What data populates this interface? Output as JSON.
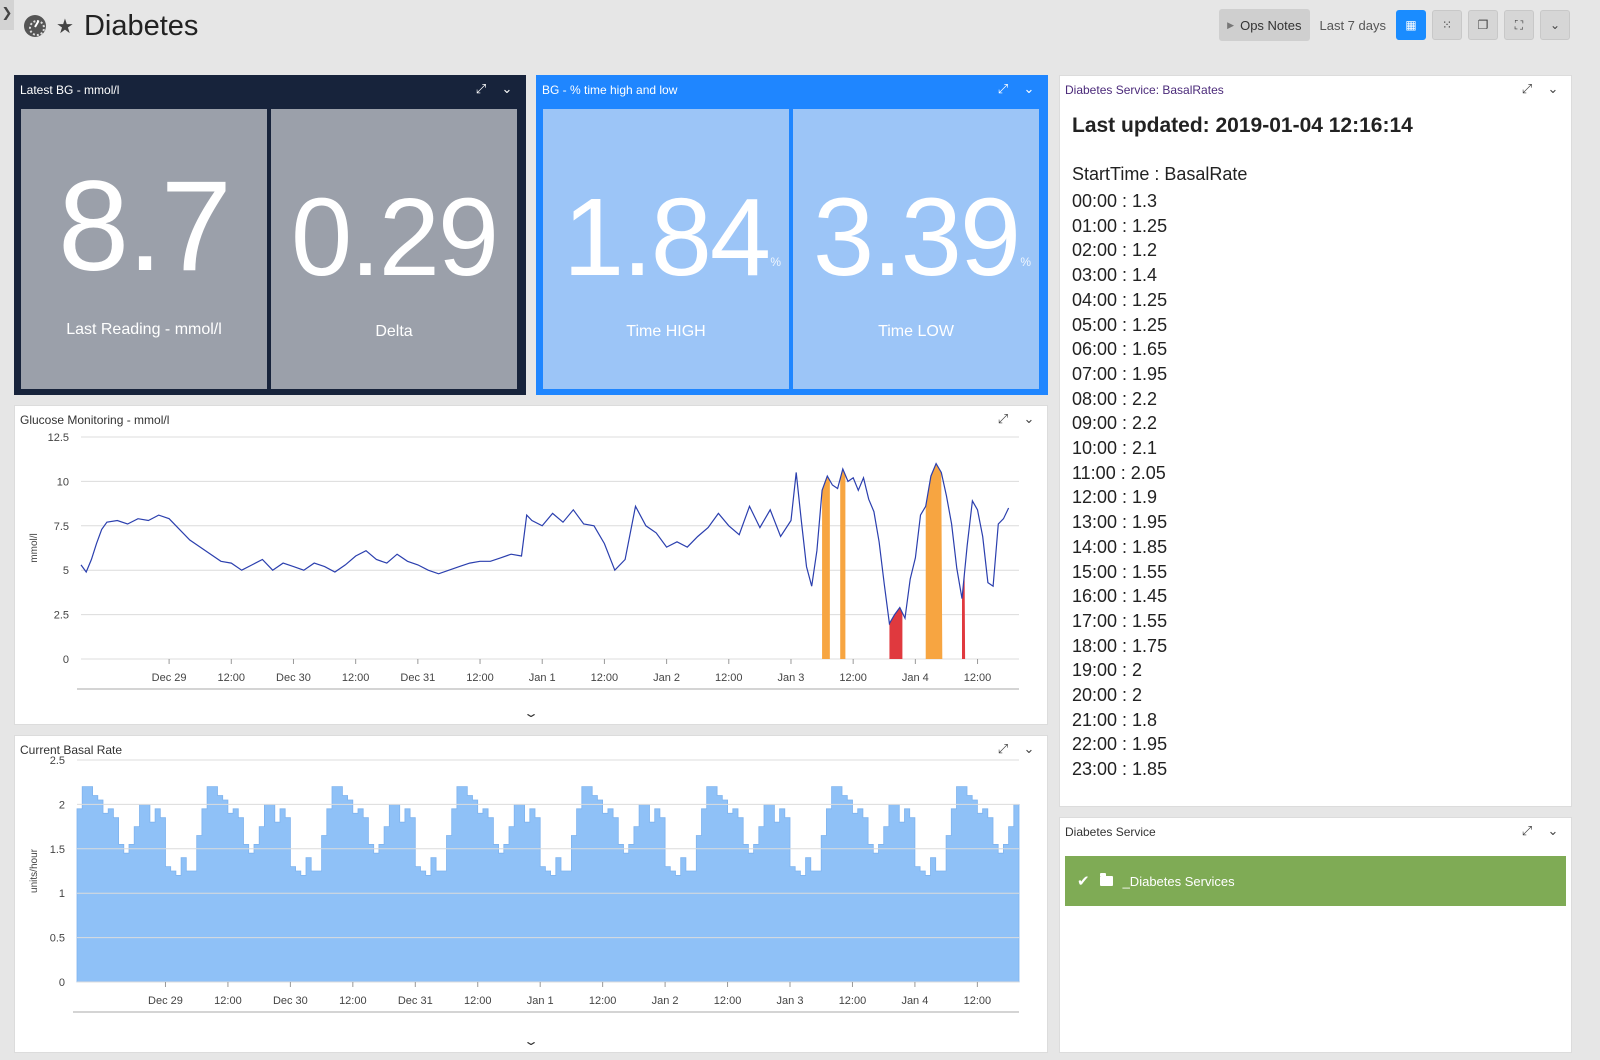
{
  "header": {
    "title": "Diabetes",
    "star_icon": "star-icon",
    "dashboard_icon": "dashboard-icon"
  },
  "toolbar": {
    "ops_notes_label": "Ops Notes",
    "time_range": "Last 7 days"
  },
  "widgets": {
    "latest_bg": {
      "title": "Latest BG - mmol/l",
      "tiles": [
        {
          "value": "8.7",
          "label": "Last Reading - mmol/l"
        },
        {
          "value": "0.29",
          "label": "Delta"
        }
      ]
    },
    "bg_time": {
      "title": "BG - % time high and low",
      "tiles": [
        {
          "value": "1.84",
          "unit": "%",
          "label": "Time HIGH"
        },
        {
          "value": "3.39",
          "unit": "%",
          "label": "Time LOW"
        }
      ]
    },
    "basal_rates": {
      "title": "Diabetes Service: BasalRates",
      "updated": "Last updated: 2019-01-04 12:16:14",
      "header": "StartTime : BasalRate",
      "rows": [
        "00:00 : 1.3",
        "01:00 : 1.25",
        "02:00 : 1.2",
        "03:00 : 1.4",
        "04:00 : 1.25",
        "05:00 : 1.25",
        "06:00 : 1.65",
        "07:00 : 1.95",
        "08:00 : 2.2",
        "09:00 : 2.2",
        "10:00 : 2.1",
        "11:00 : 2.05",
        "12:00 : 1.9",
        "13:00 : 1.95",
        "14:00 : 1.85",
        "15:00 : 1.55",
        "16:00 : 1.45",
        "17:00 : 1.55",
        "18:00 : 1.75",
        "19:00 : 2",
        "20:00 : 2",
        "21:00 : 1.8",
        "22:00 : 1.95",
        "23:00 : 1.85"
      ]
    },
    "service": {
      "title": "Diabetes Service",
      "item_label": "_Diabetes Services",
      "item_color": "#7fab55"
    }
  },
  "chart_data": [
    {
      "type": "line",
      "title": "Glucose Monitoring - mmol/l",
      "ylabel": "mmol/l",
      "ylim": [
        0,
        12.5
      ],
      "yticks": [
        "0",
        "2.5",
        "5",
        "7.5",
        "10",
        "12.5"
      ],
      "xticks": [
        "Dec 29",
        "12:00",
        "Dec 30",
        "12:00",
        "Dec 31",
        "12:00",
        "Jan 1",
        "12:00",
        "Jan 2",
        "12:00",
        "Jan 3",
        "12:00",
        "Jan 4",
        "12:00"
      ],
      "xlim_hours": [
        -17,
        164
      ],
      "line_color": "#2b3fae",
      "high_color": "#f7a541",
      "low_color": "#e0393e",
      "high_threshold": 10,
      "low_threshold": 3.9,
      "series": [
        {
          "points": [
            [
              -17,
              5.3
            ],
            [
              -16,
              4.9
            ],
            [
              -15,
              5.6
            ],
            [
              -14,
              6.5
            ],
            [
              -13,
              7.3
            ],
            [
              -12,
              7.7
            ],
            [
              -10,
              7.8
            ],
            [
              -8,
              7.6
            ],
            [
              -6,
              7.9
            ],
            [
              -4,
              7.8
            ],
            [
              -2,
              8.1
            ],
            [
              0,
              7.9
            ],
            [
              2,
              7.3
            ],
            [
              4,
              6.7
            ],
            [
              6,
              6.3
            ],
            [
              8,
              5.9
            ],
            [
              10,
              5.5
            ],
            [
              12,
              5.4
            ],
            [
              14,
              5.0
            ],
            [
              16,
              5.3
            ],
            [
              18,
              5.6
            ],
            [
              20,
              5.0
            ],
            [
              22,
              5.4
            ],
            [
              24,
              5.2
            ],
            [
              26,
              5.0
            ],
            [
              28,
              5.4
            ],
            [
              30,
              5.2
            ],
            [
              32,
              4.9
            ],
            [
              34,
              5.3
            ],
            [
              36,
              5.8
            ],
            [
              38,
              6.1
            ],
            [
              40,
              5.6
            ],
            [
              42,
              5.4
            ],
            [
              44,
              5.9
            ],
            [
              46,
              5.5
            ],
            [
              48,
              5.3
            ],
            [
              50,
              5.0
            ],
            [
              52,
              4.8
            ],
            [
              54,
              5.0
            ],
            [
              56,
              5.2
            ],
            [
              58,
              5.4
            ],
            [
              60,
              5.5
            ],
            [
              62,
              5.5
            ],
            [
              64,
              5.7
            ],
            [
              66,
              5.9
            ],
            [
              68,
              5.8
            ],
            [
              69,
              8.1
            ],
            [
              70,
              7.8
            ],
            [
              72,
              7.5
            ],
            [
              74,
              8.2
            ],
            [
              76,
              7.7
            ],
            [
              78,
              8.4
            ],
            [
              80,
              7.6
            ],
            [
              82,
              7.5
            ],
            [
              84,
              6.5
            ],
            [
              86,
              5.0
            ],
            [
              88,
              5.6
            ],
            [
              90,
              8.6
            ],
            [
              92,
              7.5
            ],
            [
              94,
              7.1
            ],
            [
              96,
              6.3
            ],
            [
              98,
              6.6
            ],
            [
              100,
              6.3
            ],
            [
              102,
              6.9
            ],
            [
              104,
              7.4
            ],
            [
              106,
              8.2
            ],
            [
              108,
              7.5
            ],
            [
              110,
              7.0
            ],
            [
              112,
              8.6
            ],
            [
              114,
              7.4
            ],
            [
              116,
              8.4
            ],
            [
              118,
              6.9
            ],
            [
              120,
              7.8
            ],
            [
              121,
              10.5
            ],
            [
              122,
              7.8
            ],
            [
              123,
              5.2
            ],
            [
              124,
              4.1
            ],
            [
              125,
              6.1
            ],
            [
              126,
              9.5
            ],
            [
              127,
              10.3
            ],
            [
              128,
              9.8
            ],
            [
              129,
              9.6
            ],
            [
              130,
              10.7
            ],
            [
              131,
              10.0
            ],
            [
              132,
              10.2
            ],
            [
              133,
              9.5
            ],
            [
              134,
              10.2
            ],
            [
              135,
              9.0
            ],
            [
              136,
              8.3
            ],
            [
              137,
              6.6
            ],
            [
              138,
              4.2
            ],
            [
              139,
              2.0
            ],
            [
              140,
              2.5
            ],
            [
              141,
              2.9
            ],
            [
              142,
              2.3
            ],
            [
              143,
              4.5
            ],
            [
              144,
              5.7
            ],
            [
              145,
              8.1
            ],
            [
              146,
              8.6
            ],
            [
              147,
              10.3
            ],
            [
              148,
              11.0
            ],
            [
              149,
              10.5
            ],
            [
              150,
              9.2
            ],
            [
              151,
              7.6
            ],
            [
              152,
              5.1
            ],
            [
              153,
              3.4
            ],
            [
              154,
              6.4
            ],
            [
              155,
              8.9
            ],
            [
              156,
              8.4
            ],
            [
              157,
              6.9
            ],
            [
              158,
              4.3
            ],
            [
              159,
              4.1
            ],
            [
              160,
              7.6
            ],
            [
              161,
              7.9
            ],
            [
              162,
              8.5
            ]
          ],
          "high_intervals": [
            [
              126,
              127.5
            ],
            [
              129.5,
              130.5
            ],
            [
              146,
              149.2
            ]
          ],
          "low_intervals": [
            [
              139,
              141.5
            ],
            [
              153,
              153.6
            ]
          ]
        }
      ]
    },
    {
      "type": "area",
      "title": "Current Basal Rate",
      "ylabel": "units/hour",
      "ylim": [
        0,
        2.5
      ],
      "yticks": [
        "0",
        "0.5",
        "1",
        "1.5",
        "2",
        "2.5"
      ],
      "xticks": [
        "Dec 29",
        "12:00",
        "Dec 30",
        "12:00",
        "Dec 31",
        "12:00",
        "Jan 1",
        "12:00",
        "Jan 2",
        "12:00",
        "Jan 3",
        "12:00",
        "Jan 4",
        "12:00"
      ],
      "fill_color": "#8fc1f7",
      "daily_profile": [
        1.3,
        1.25,
        1.2,
        1.4,
        1.25,
        1.25,
        1.65,
        1.95,
        2.2,
        2.2,
        2.1,
        2.05,
        1.9,
        1.95,
        1.85,
        1.55,
        1.45,
        1.55,
        1.75,
        2,
        2,
        1.8,
        1.95,
        1.85
      ],
      "xlim_hours": [
        -17,
        164
      ]
    }
  ]
}
